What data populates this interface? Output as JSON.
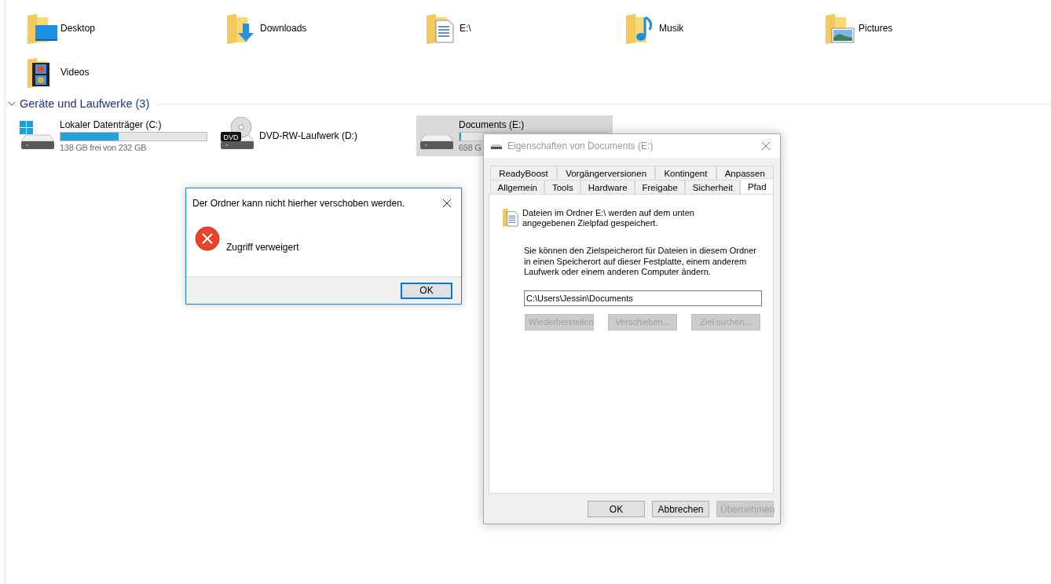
{
  "explorer": {
    "folders": [
      {
        "name": "Desktop",
        "kind": "desktop"
      },
      {
        "name": "Downloads",
        "kind": "downloads"
      },
      {
        "name": "E:\\",
        "kind": "documents"
      },
      {
        "name": "Musik",
        "kind": "music"
      },
      {
        "name": "Pictures",
        "kind": "pictures"
      },
      {
        "name": "Videos",
        "kind": "videos"
      }
    ],
    "section": {
      "title": "Geräte und Laufwerke (3)",
      "expanded": true
    },
    "drives": [
      {
        "name": "Lokaler Datenträger (C:)",
        "kind": "system",
        "level": 0.4,
        "free": "138 GB frei von 232 GB",
        "selected": false
      },
      {
        "name": "DVD-RW-Laufwerk (D:)",
        "kind": "dvd",
        "icon_label": "DVD",
        "selected": false
      },
      {
        "name": "Documents (E:)",
        "kind": "hdd",
        "level": 0.01,
        "free": "698 G",
        "selected": true
      }
    ]
  },
  "properties": {
    "title": "Eigenschaften von Documents (E:)",
    "tab_rows": [
      [
        {
          "label": "ReadyBoost",
          "selected": false
        },
        {
          "label": "Vorgängerversionen",
          "selected": false
        },
        {
          "label": "Kontingent",
          "selected": false
        },
        {
          "label": "Anpassen",
          "selected": false
        }
      ],
      [
        {
          "label": "Allgemein",
          "selected": false
        },
        {
          "label": "Tools",
          "selected": false
        },
        {
          "label": "Hardware",
          "selected": false
        },
        {
          "label": "Freigabe",
          "selected": false
        },
        {
          "label": "Sicherheit",
          "selected": false
        },
        {
          "label": "Pfad",
          "selected": true
        }
      ]
    ],
    "intro": "Dateien im Ordner E:\\ werden auf dem unten angegebenen Zielpfad gespeichert.",
    "description": "Sie können den Zielspeicherort für Dateien in diesem Ordner in einen Speicherort auf dieser Festplatte, einem anderem Laufwerk oder einem anderen Computer ändern.",
    "path": "C:\\Users\\Jessin\\Documents",
    "path_buttons": [
      {
        "label": "Wiederherstellen",
        "disabled": true
      },
      {
        "label": "Verschieben...",
        "disabled": true
      },
      {
        "label": "Ziel suchen...",
        "disabled": true
      }
    ],
    "buttons": [
      {
        "label": "OK",
        "disabled": false
      },
      {
        "label": "Abbrechen",
        "disabled": false
      },
      {
        "label": "Übernehmen",
        "disabled": true
      }
    ]
  },
  "error_dialog": {
    "title": "Der Ordner kann nicht hierher verschoben werden.",
    "message": "Zugriff verweigert",
    "buttons": [
      {
        "label": "OK",
        "default": true
      }
    ]
  }
}
